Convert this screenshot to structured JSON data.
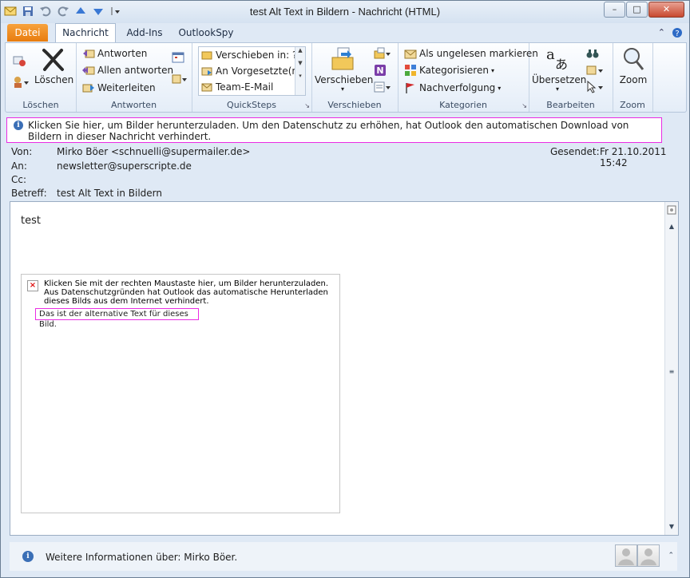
{
  "window": {
    "title": "test Alt Text in Bildern  -  Nachricht (HTML)",
    "controls": {
      "minimize": "–",
      "maximize": "□",
      "close": "✕"
    }
  },
  "tabs": [
    {
      "label": "Datei"
    },
    {
      "label": "Nachricht"
    },
    {
      "label": "Add-Ins"
    },
    {
      "label": "OutlookSpy"
    }
  ],
  "ribbon": {
    "loeschen": {
      "delete_label": "Löschen",
      "group_label": "Löschen"
    },
    "antworten": {
      "reply": "Antworten",
      "reply_all": "Allen antworten",
      "forward": "Weiterleiten",
      "group_label": "Antworten"
    },
    "quicksteps": {
      "items": [
        "Verschieben in: ?",
        "An Vorgesetzte(n)",
        "Team-E-Mail"
      ],
      "group_label": "QuickSteps"
    },
    "verschieben": {
      "move_label": "Verschieben",
      "group_label": "Verschieben"
    },
    "kategorien": {
      "mark_unread": "Als ungelesen markieren",
      "categorize": "Kategorisieren",
      "followup": "Nachverfolgung",
      "group_label": "Kategorien"
    },
    "bearbeiten": {
      "translate": "Übersetzen",
      "group_label": "Bearbeiten"
    },
    "zoom": {
      "zoom": "Zoom",
      "group_label": "Zoom"
    }
  },
  "infobar": {
    "text": "Klicken Sie hier, um Bilder herunterzuladen. Um den Datenschutz zu erhöhen, hat Outlook den automatischen Download von Bildern in dieser Nachricht verhindert."
  },
  "headers": {
    "from_label": "Von:",
    "from_value": "Mirko Böer <schnuelli@supermailer.de>",
    "to_label": "An:",
    "to_value": "newsletter@superscripte.de",
    "cc_label": "Cc:",
    "cc_value": "",
    "subject_label": "Betreff:",
    "subject_value": "test Alt Text in Bildern",
    "sent_label": "Gesendet:",
    "sent_value": "Fr 21.10.2011 15:42"
  },
  "body": {
    "text": "test",
    "image_placeholder": "Klicken Sie mit der rechten Maustaste hier, um Bilder herunterzuladen. Aus Datenschutzgründen hat Outlook das automatische Herunterladen dieses Bilds aus dem Internet verhindert.",
    "alt_text": "Das ist der alternative Text für dieses Bild."
  },
  "people_pane": {
    "info": "Weitere Informationen über: Mirko Böer."
  },
  "colors": {
    "accent_orange": "#e87c0e",
    "highlight_magenta": "#ea2ce4",
    "frame_blue": "#dfe9f5"
  }
}
